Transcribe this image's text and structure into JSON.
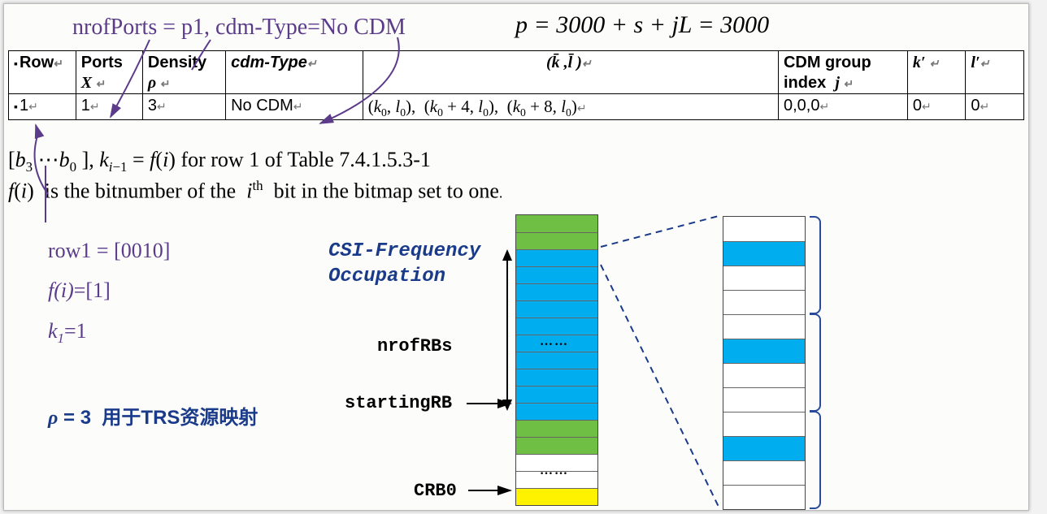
{
  "top_note": {
    "left": "nrofPorts = p1, cdm-Type=No CDM",
    "right_html": "p = 3000 + s + jL = 3000"
  },
  "table": {
    "headers": {
      "row": "Row",
      "ports": "Ports",
      "portsX": "X",
      "density": "Density",
      "densityRho": "ρ",
      "cdmtype": "cdm-Type",
      "kl": "(k̄ ,l̄ )",
      "cdmgroup": "CDM group index  j",
      "kprime": "k′",
      "lprime": "l′"
    },
    "row1": {
      "row": "1",
      "ports": "1",
      "density": "3",
      "cdmtype": "No CDM",
      "kl": "(k₀, l₀),  (k₀ + 4, l₀),  (k₀ + 8, l₀)",
      "cdmgroup": "0,0,0",
      "kprime": "0",
      "lprime": "0"
    }
  },
  "explain": {
    "line1_a": "[b",
    "line1_b": "3",
    "line1_c": "⋯b",
    "line1_d": "0",
    "line1_e": "], k",
    "line1_f": "i−1",
    "line1_g": " = f(i) for row 1 of Table 7.4.1.5.3-1",
    "line2_a": "f(i)  is the bitnumber of the  i",
    "line2_b": "th",
    "line2_c": "  bit in the bitmap set to one."
  },
  "left_block": {
    "row1": "row1 = [0010]",
    "fi": "f(i)=[1]",
    "ki": "k₁=1",
    "rho": "ρ = 3  用于TRS资源映射"
  },
  "labels": {
    "csi_freq": "CSI-Frequency Occupation",
    "nrofrbs": "nrofRBs",
    "startingrb": "startingRB",
    "crb0": "CRB0",
    "dots": "……"
  },
  "left_grid_pattern": [
    "green",
    "green",
    "blue",
    "blue",
    "blue",
    "blue",
    "blue",
    "blue",
    "blue",
    "blue",
    "blue",
    "blue",
    "green",
    "green",
    "white",
    "white",
    "yellow"
  ],
  "right_grid_pattern": [
    "grid",
    "blue",
    "grid",
    "grid",
    "grid",
    "blue",
    "grid",
    "grid",
    "grid",
    "blue",
    "grid",
    "grid"
  ]
}
